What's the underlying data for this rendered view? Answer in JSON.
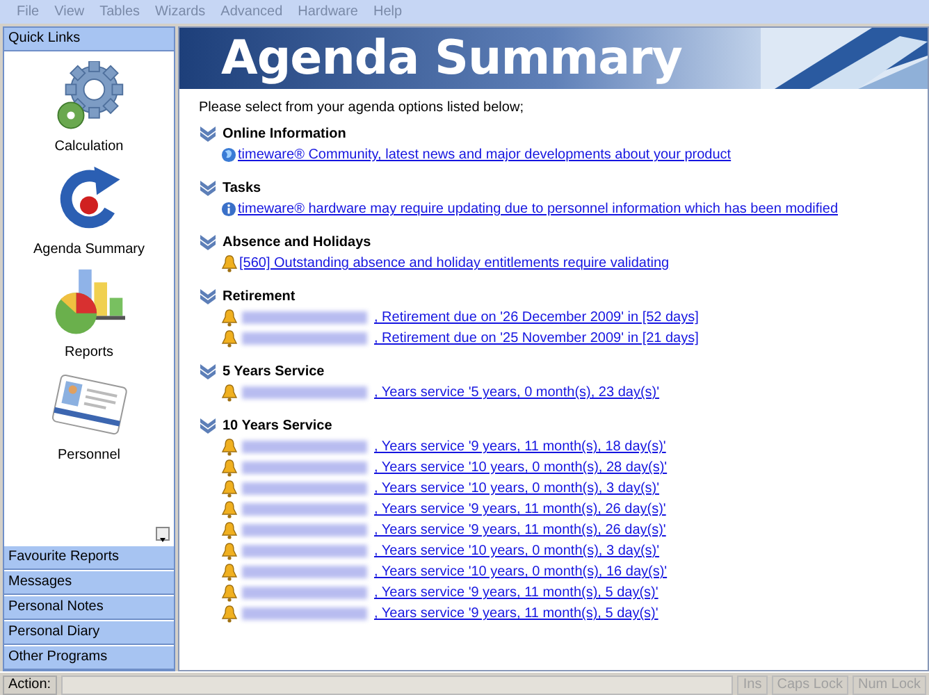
{
  "menu": [
    "File",
    "View",
    "Tables",
    "Wizards",
    "Advanced",
    "Hardware",
    "Help"
  ],
  "quick_links": {
    "title": "Quick Links",
    "items": [
      {
        "label": "Calculation",
        "kind": "gear"
      },
      {
        "label": "Agenda Summary",
        "kind": "agenda"
      },
      {
        "label": "Reports",
        "kind": "chart"
      },
      {
        "label": "Personnel",
        "kind": "card"
      }
    ]
  },
  "nav_sections": [
    "Favourite Reports",
    "Messages",
    "Personal Notes",
    "Personal Diary",
    "Other Programs"
  ],
  "banner_title": "Agenda Summary",
  "intro": "Please select from your agenda options listed below;",
  "sections": [
    {
      "title": "Online Information",
      "items": [
        {
          "kind": "globe",
          "text": "timeware® Community, latest news and major developments about your product",
          "name_blurred": false
        }
      ]
    },
    {
      "title": "Tasks",
      "items": [
        {
          "kind": "info",
          "text": "timeware® hardware may require updating due to personnel information which has been modified",
          "name_blurred": false
        }
      ]
    },
    {
      "title": "Absence and Holidays",
      "items": [
        {
          "kind": "bell",
          "text": "[560] Outstanding absence and holiday entitlements require validating",
          "name_blurred": false
        }
      ]
    },
    {
      "title": "Retirement",
      "items": [
        {
          "kind": "bell",
          "text": ", Retirement due on '26 December 2009' in [52 days]",
          "name_blurred": true
        },
        {
          "kind": "bell",
          "text": ", Retirement due on '25 November 2009' in [21 days]",
          "name_blurred": true
        }
      ]
    },
    {
      "title": "5 Years Service",
      "items": [
        {
          "kind": "bell",
          "text": ", Years service '5 years, 0 month(s), 23 day(s)'",
          "name_blurred": true
        }
      ]
    },
    {
      "title": "10 Years Service",
      "items": [
        {
          "kind": "bell",
          "text": ", Years service '9 years, 11 month(s), 18 day(s)'",
          "name_blurred": true
        },
        {
          "kind": "bell",
          "text": ", Years service '10 years, 0 month(s), 28 day(s)'",
          "name_blurred": true
        },
        {
          "kind": "bell",
          "text": ", Years service '10 years, 0 month(s), 3 day(s)'",
          "name_blurred": true
        },
        {
          "kind": "bell",
          "text": ", Years service '9 years, 11 month(s), 26 day(s)'",
          "name_blurred": true
        },
        {
          "kind": "bell",
          "text": ", Years service '9 years, 11 month(s), 26 day(s)'",
          "name_blurred": true
        },
        {
          "kind": "bell",
          "text": ", Years service '10 years, 0 month(s), 3 day(s)'",
          "name_blurred": true
        },
        {
          "kind": "bell",
          "text": ", Years service '10 years, 0 month(s), 16 day(s)'",
          "name_blurred": true
        },
        {
          "kind": "bell",
          "text": ", Years service '9 years, 11 month(s), 5 day(s)'",
          "name_blurred": true
        },
        {
          "kind": "bell",
          "text": ", Years service '9 years, 11 month(s), 5 day(s)'",
          "name_blurred": true
        }
      ]
    }
  ],
  "status_bar": {
    "label": "Action:",
    "indicators": [
      "Ins",
      "Caps Lock",
      "Num Lock"
    ]
  }
}
